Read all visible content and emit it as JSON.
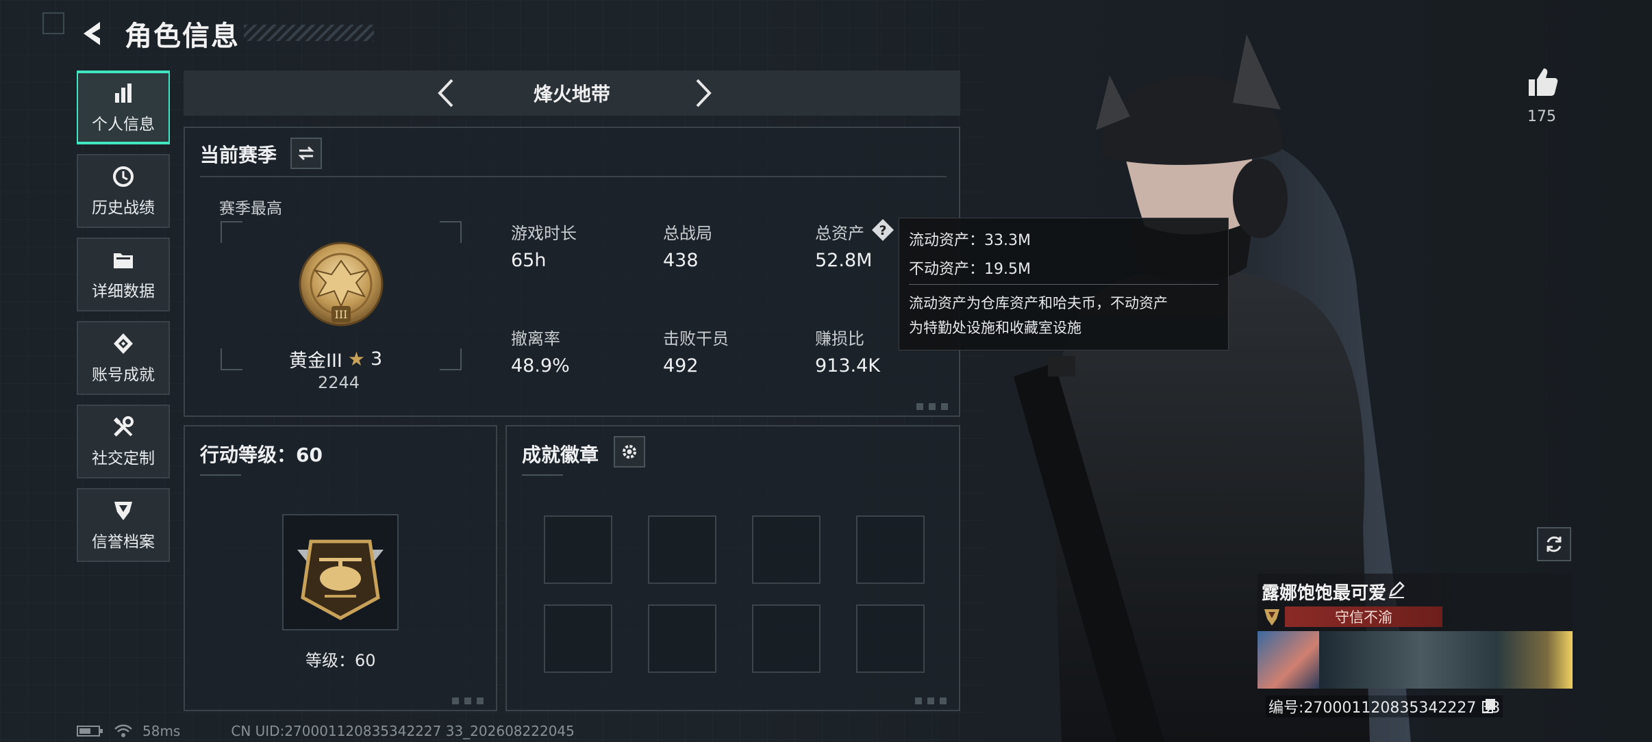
{
  "header": {
    "title": "角色信息"
  },
  "sidebar": {
    "items": [
      {
        "label": "个人信息",
        "icon": "bar-chart-icon",
        "active": true
      },
      {
        "label": "历史战绩",
        "icon": "history-icon",
        "active": false
      },
      {
        "label": "详细数据",
        "icon": "folder-icon",
        "active": false
      },
      {
        "label": "账号成就",
        "icon": "achievement-icon",
        "active": false
      },
      {
        "label": "社交定制",
        "icon": "tools-icon",
        "active": false
      },
      {
        "label": "信誉档案",
        "icon": "credit-shield-icon",
        "active": false
      }
    ]
  },
  "mode_switcher": {
    "label": "烽火地带"
  },
  "season": {
    "title": "当前赛季",
    "best_label": "赛季最高",
    "rank_name": "黄金III",
    "rank_stars": "3",
    "rank_score": "2244",
    "stats": [
      {
        "label": "游戏时长",
        "value": "65h"
      },
      {
        "label": "总战局",
        "value": "438"
      },
      {
        "label": "总资产",
        "value": "52.8M"
      },
      {
        "label": "撤离率",
        "value": "48.9%"
      },
      {
        "label": "击败干员",
        "value": "492"
      },
      {
        "label": "赚损比",
        "value": "913.4K"
      }
    ]
  },
  "tooltip": {
    "liquid": "流动资产：33.3M",
    "fixed": "不动资产：19.5M",
    "desc_line1": "流动资产为仓库资产和哈夫币，不动资产",
    "desc_line2": "为特勤处设施和收藏室设施"
  },
  "action_level": {
    "title": "行动等级：60",
    "level_label": "等级：60"
  },
  "badges": {
    "title": "成就徽章",
    "slots": 8
  },
  "player": {
    "likes": "175",
    "name": "露娜饱饱最可爱",
    "reputation": "守信不渝",
    "uid_card": "编号:270001120835342227 33",
    "uid_line": "CN UID:270001120835342227 33_202608222045"
  },
  "status": {
    "ping": "58ms"
  },
  "colors": {
    "accent": "#3fe6c0",
    "reputation_bg": "#8a2a26",
    "gold": "#c9a25a"
  }
}
